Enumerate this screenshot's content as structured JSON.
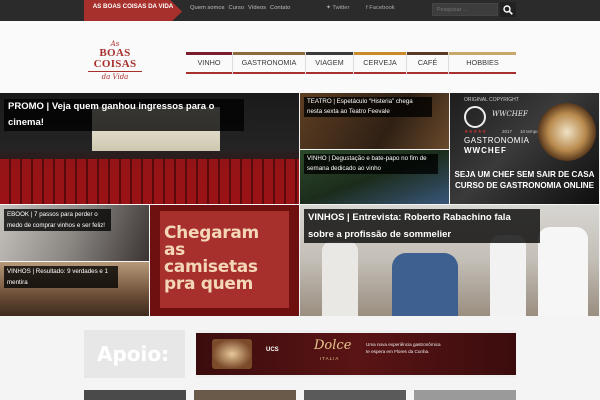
{
  "topbar": {
    "brand": "AS BOAS COISAS DA VIDA",
    "links": [
      "Quem somos",
      "Curso",
      "Vídeos",
      "Contato"
    ],
    "twitter": "Twitter",
    "facebook": "Facebook",
    "search_placeholder": "Pesquisar ..."
  },
  "logo": {
    "line1": "As",
    "line2": "BOAS COISAS",
    "line3": "da Vida"
  },
  "nav": [
    {
      "label": "VINHO",
      "color": "#7a1d2e"
    },
    {
      "label": "GASTRONOMIA",
      "color": "#8b6a3e"
    },
    {
      "label": "VIAGEM",
      "color": "#3a3a3a"
    },
    {
      "label": "CERVEJA",
      "color": "#c98a2a"
    },
    {
      "label": "CAFÉ",
      "color": "#5a3a26"
    },
    {
      "label": "HOBBIES",
      "color": "#c9a96b"
    }
  ],
  "tiles": {
    "promo": "PROMO | Veja quem ganhou ingressos para o cinema!",
    "teatro": "TEATRO | Espetáculo “Histeria” chega nesta sexta ao Teatro Feevale",
    "vinho_deg": "VINHO | Degustação e bate-papo no fim de semana dedicado ao vinho",
    "chef": {
      "original": "ORIGINAL COPYRIGHT",
      "brand": "GASTRONOMIA",
      "logo": "WWCHEF",
      "year": "2017",
      "episodes": "10 temporadas",
      "caption": "SEJA UM CHEF SEM SAIR DE CASA CURSO DE GASTRONOMIA ONLINE"
    },
    "ebook": "EBOOK | 7 passos para perder o medo de comprar vinhos e ser feliz!",
    "resultado": "VINHOS | Resultado: 9 verdades e 1 mentira",
    "camisetas": "Chegaram as camisetas pra quem",
    "sommelier": "VINHOS | Entrevista: Roberto Rabachino fala sobre a profissão de sommelier"
  },
  "apoio": {
    "label": "Apoio:",
    "ad_brand": "Dolce",
    "ad_sub": "ITALIA",
    "ad_ucs": "UCS",
    "ad_text": "Uma nova experiência gastronômica te espera em Flores da Cunha."
  }
}
